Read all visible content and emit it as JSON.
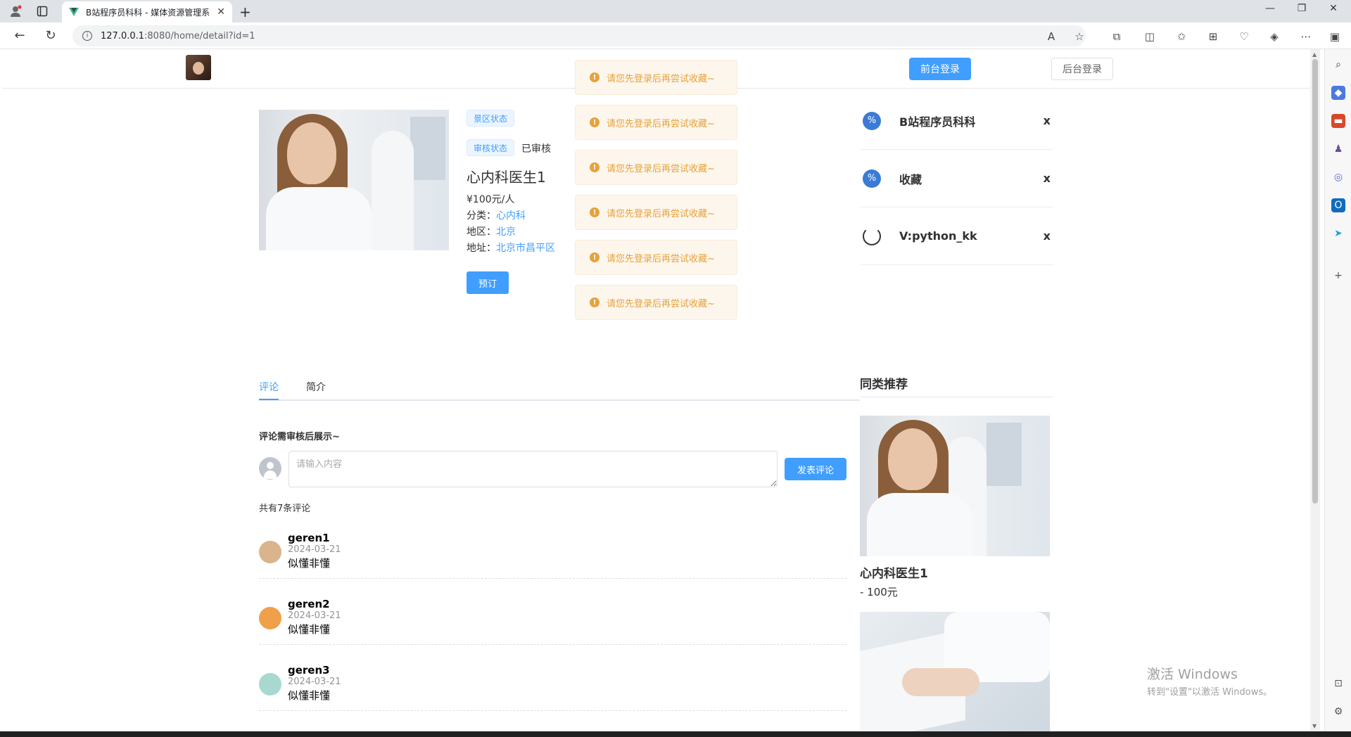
{
  "browser": {
    "tab_title": "B站程序员科科 - 媒体资源管理系",
    "url_host": "127.0.0.1",
    "url_path": ":8080/home/detail?id=1"
  },
  "header": {
    "front_login": "前台登录",
    "back_login": "后台登录"
  },
  "product": {
    "tag_scenic": "景区状态",
    "tag_audit": "审核状态",
    "audit_value": "已审核",
    "title": "心内科医生1",
    "price": "¥100元/人",
    "category_label": "分类：",
    "category_value": "心内科",
    "region_label": "地区：",
    "region_value": "北京",
    "address_label": "地址：",
    "address_value": "北京市昌平区",
    "book_button": "预订"
  },
  "warnings": [
    "请您先登录后再尝试收藏~",
    "请您先登录后再尝试收藏~",
    "请您先登录后再尝试收藏~",
    "请您先登录后再尝试收藏~",
    "请您先登录后再尝试收藏~",
    "请您先登录后再尝试收藏~"
  ],
  "side_list": [
    {
      "label": "B站程序员科科",
      "close": "x",
      "icon": "percent-icon"
    },
    {
      "label": "收藏",
      "close": "x",
      "icon": "percent-icon"
    },
    {
      "label": "V:python_kk",
      "close": "x",
      "icon": "refresh-icon"
    }
  ],
  "tabs": {
    "comments": "评论",
    "intro": "简介"
  },
  "comment_form": {
    "note": "评论需审核后展示~",
    "placeholder": "请输入内容",
    "submit": "发表评论"
  },
  "comment_count": "共有7条评论",
  "comments": [
    {
      "name": "geren1",
      "date": "2024-03-21",
      "text": "似懂非懂",
      "avatar_color": "#d9b48c"
    },
    {
      "name": "geren2",
      "date": "2024-03-21",
      "text": "似懂非懂",
      "avatar_color": "#f0a04b"
    },
    {
      "name": "geren3",
      "date": "2024-03-21",
      "text": "似懂非懂",
      "avatar_color": "#a8d8d0"
    }
  ],
  "recommend": {
    "title": "同类推荐",
    "item1_name": "心内科医生1",
    "item1_price": "- 100元"
  },
  "watermark": {
    "line1": "激活 Windows",
    "line2": "转到\"设置\"以激活 Windows。"
  },
  "colors": {
    "primary": "#409eff",
    "warning": "#e6a23c",
    "warning_bg": "#fdf6ec"
  }
}
